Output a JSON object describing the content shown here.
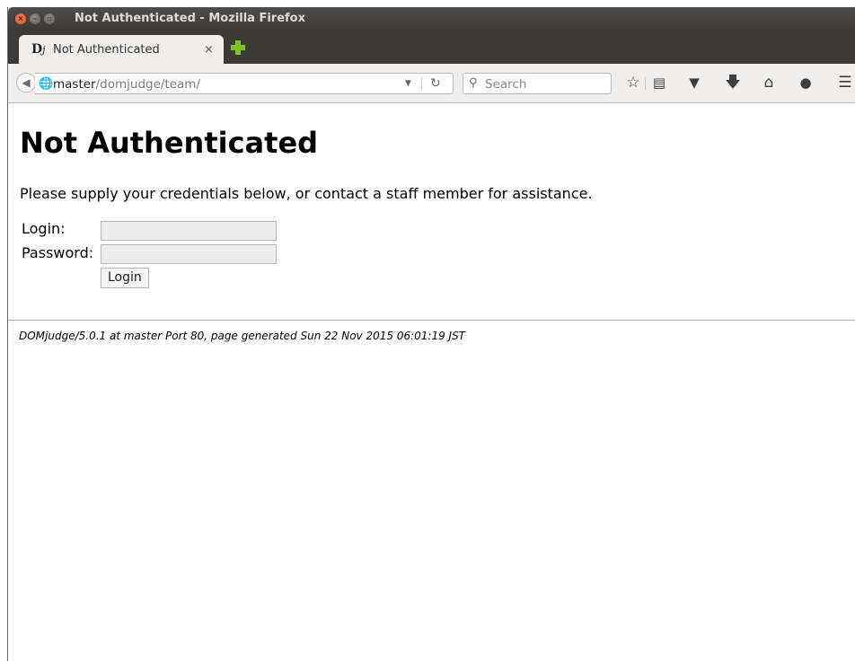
{
  "window": {
    "title": "Not Authenticated - Mozilla Firefox"
  },
  "tab": {
    "favicon": "Dj",
    "title": "Not Authenticated",
    "close": "×"
  },
  "navbar": {
    "url_host": "master",
    "url_path": "/domjudge/team/",
    "search_placeholder": "Search"
  },
  "page": {
    "heading": "Not Authenticated",
    "intro": "Please supply your credentials below, or contact a staff member for assistance.",
    "login_label": "Login:",
    "password_label": "Password:",
    "login_value": "",
    "password_value": "",
    "submit_label": "Login",
    "footer": "DOMjudge/5.0.1 at master Port 80, page generated Sun 22 Nov 2015 06:01:19 JST"
  },
  "icons": {
    "window_close": "close-icon",
    "window_minimize": "minimize-icon",
    "window_maximize": "maximize-icon",
    "back": "back-arrow-icon",
    "site_identity": "globe-icon",
    "url_dropdown": "dropdown-icon",
    "reload": "reload-icon",
    "search": "search-icon",
    "bookmark": "star-icon",
    "reading_list": "clipboard-icon",
    "pocket": "pocket-icon",
    "downloads": "download-icon",
    "home": "home-icon",
    "hello": "chat-icon",
    "menu": "hamburger-menu-icon",
    "new_tab": "plus-icon"
  },
  "colors": {
    "titlebar": "#3c3b37",
    "close_button": "#df4c1a",
    "new_tab_plus": "#7cc428",
    "toolbar": "#f0efed"
  }
}
